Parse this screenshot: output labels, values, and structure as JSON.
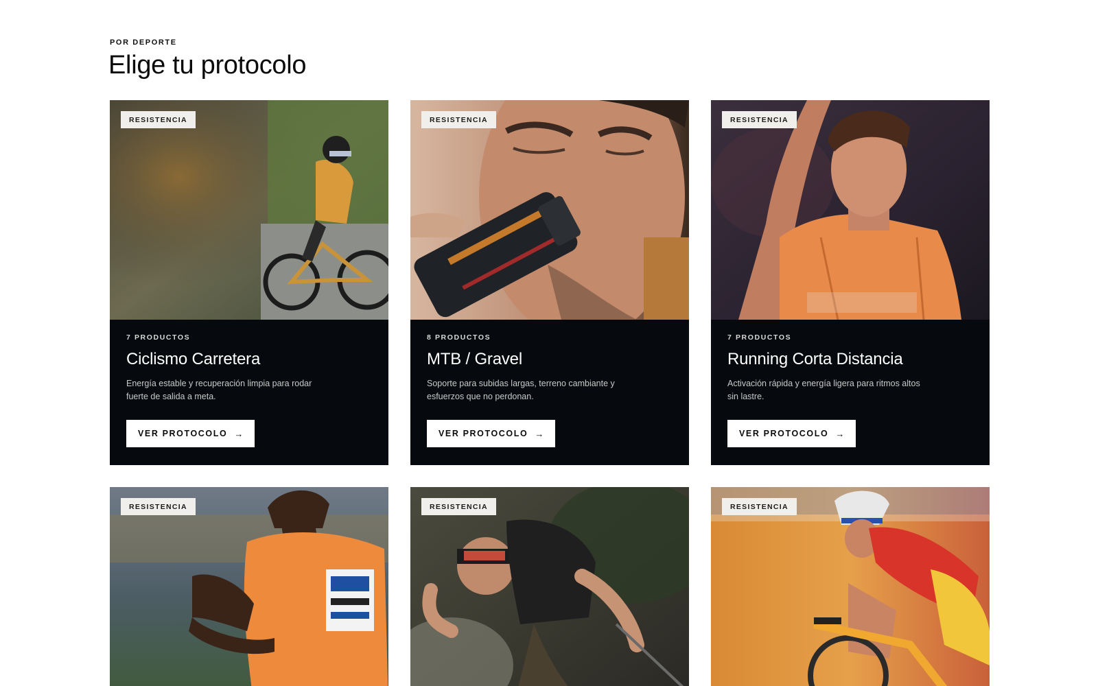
{
  "section": {
    "eyebrow": "POR DEPORTE",
    "title": "Elige tu protocolo"
  },
  "cards": [
    {
      "tag": "RESISTENCIA",
      "count": "7 PRODUCTOS",
      "title": "Ciclismo Carretera",
      "description": "Energía estable y recuperación limpia para rodar fuerte de salida a meta.",
      "cta": "VER PROTOCOLO",
      "cta_icon": "arrow-right-icon"
    },
    {
      "tag": "RESISTENCIA",
      "count": "8 PRODUCTOS",
      "title": "MTB / Gravel",
      "description": "Soporte para subidas largas, terreno cambiante y esfuerzos que no perdonan.",
      "cta": "VER PROTOCOLO",
      "cta_icon": "arrow-right-icon"
    },
    {
      "tag": "RESISTENCIA",
      "count": "7 PRODUCTOS",
      "title": "Running Corta Distancia",
      "description": "Activación rápida y energía ligera para ritmos altos sin lastre.",
      "cta": "VER PROTOCOLO",
      "cta_icon": "arrow-right-icon"
    },
    {
      "tag": "RESISTENCIA"
    },
    {
      "tag": "RESISTENCIA"
    },
    {
      "tag": "RESISTENCIA"
    }
  ],
  "colors": {
    "card_background": "#060a0e",
    "tag_background": "#f1efec",
    "button_background": "#ffffff"
  }
}
